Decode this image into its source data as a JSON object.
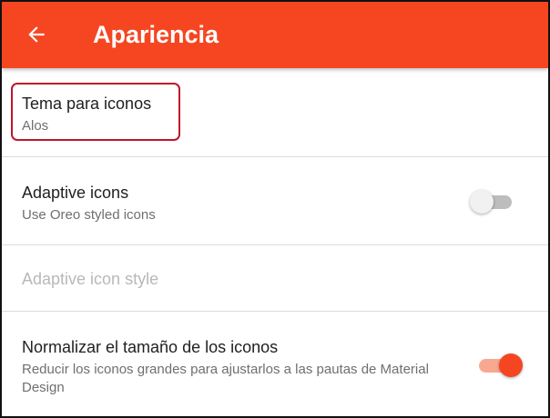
{
  "appbar": {
    "title": "Apariencia",
    "back_icon": "arrow-left-icon",
    "background_color": "#f54621"
  },
  "settings": {
    "icon_theme": {
      "title": "Tema para iconos",
      "summary": "Alos"
    },
    "adaptive_icons": {
      "title": "Adaptive icons",
      "summary": "Use Oreo styled icons",
      "enabled": false
    },
    "adaptive_icon_style": {
      "title": "Adaptive icon style",
      "disabled": true
    },
    "normalize_size": {
      "title": "Normalizar el tamaño de los iconos",
      "summary": "Reducir los iconos grandes para ajustarlos a las pautas de Material Design",
      "enabled": true
    }
  },
  "colors": {
    "accent": "#f54621",
    "highlight_border": "#c0152a"
  }
}
